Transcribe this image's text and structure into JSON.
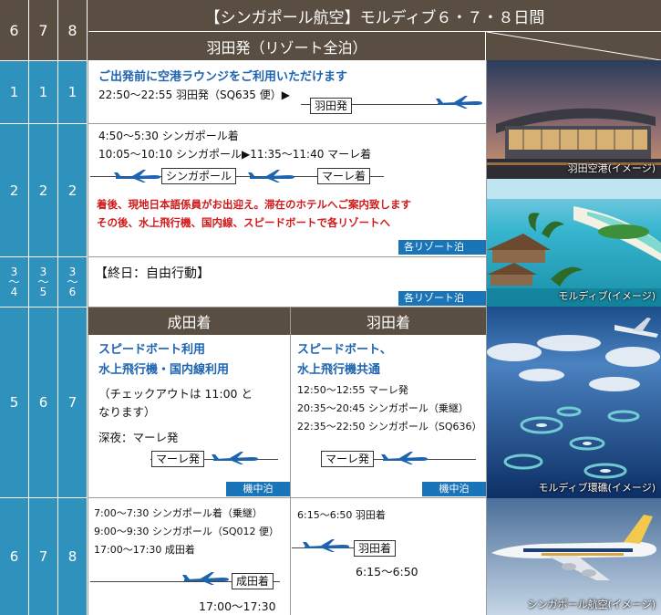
{
  "header": {
    "days": [
      "6",
      "7",
      "8"
    ],
    "title": "【シンガポール航空】モルディブ６・７・８日間",
    "subtitle": "羽田発（リゾート全泊）"
  },
  "rows": [
    {
      "days": [
        "1",
        "1",
        "1"
      ],
      "heading": "ご出発前に空港ラウンジをご利用いただけます",
      "line1": "22:50〜22:55 羽田発（SQ635 便）▶",
      "box": "羽田発"
    },
    {
      "days": [
        "2",
        "2",
        "2"
      ],
      "line1": "4:50〜5:30 シンガポール着",
      "line2": "10:05〜10:10 シンガポール▶11:35〜11:40 マーレ着",
      "box1": "シンガポール",
      "box2": "マーレ着",
      "note1": "着後、現地日本語係員がお出迎え。滞在のホテルへご案内致します",
      "note2": "その後、水上飛行機、国内線、スピードボートで各リゾートへ",
      "badge": "各リゾート泊"
    },
    {
      "days": [
        [
          "3",
          "〜",
          "4"
        ],
        [
          "3",
          "〜",
          "5"
        ],
        [
          "3",
          "〜",
          "6"
        ]
      ],
      "text": "【終日：自由行動】",
      "badge": "各リゾート泊"
    },
    {
      "days": [
        "5",
        "6",
        "7"
      ],
      "left": {
        "header": "成田着",
        "h1": "スピードボート利用",
        "h2": "水上飛行機・国内線利用",
        "t1": "（チェックアウトは 11:00 と",
        "t2": "なります）",
        "t3": "深夜：マーレ発",
        "box": "マーレ発",
        "badge": "機中泊"
      },
      "right": {
        "header": "羽田着",
        "h1": "スピードボート、",
        "h2": "水上飛行機共通",
        "t1": "12:50〜12:55 マーレ発",
        "t2": "20:35〜20:45 シンガポール（乗継）",
        "t3": "22:35〜22:50 シンガポール（SQ636）",
        "box": "マーレ発",
        "badge": "機中泊"
      }
    },
    {
      "days": [
        "6",
        "7",
        "8"
      ],
      "left": {
        "t1": "7:00〜7:30 シンガポール着（乗継）",
        "t2": "9:00〜9:30 シンガポール（SQ012 便）",
        "t3": "17:00〜17:30 成田着",
        "box": "成田着",
        "time": "17:00〜17:30"
      },
      "right": {
        "t1": "6:15〜6:50 羽田着",
        "box": "羽田着",
        "time": "6:15〜6:50"
      }
    }
  ],
  "photos": [
    {
      "caption": "羽田空港(イメージ)"
    },
    {
      "caption": "モルディブ(イメージ)"
    },
    {
      "caption": "モルディブ環礁(イメージ)"
    },
    {
      "caption": "シンガポール航空(イメージ)"
    }
  ],
  "colors": {
    "header_brown": "#5a4e43",
    "day_blue": "#2f92bd",
    "badge_blue": "#1a74b8",
    "heading_blue": "#1d63b0",
    "note_red": "#d11a1a"
  }
}
